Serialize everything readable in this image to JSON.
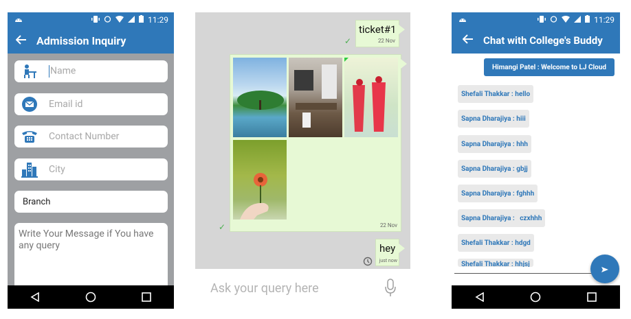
{
  "status": {
    "time": "11:29"
  },
  "screen1": {
    "title": "Admission Inquiry",
    "fields": [
      {
        "placeholder": "Name",
        "icon": "person-at-desk-icon"
      },
      {
        "placeholder": "Email id",
        "icon": "envelope-icon"
      },
      {
        "placeholder": "Contact Number",
        "icon": "telephone-icon"
      },
      {
        "placeholder": "City",
        "icon": "city-buildings-icon"
      }
    ],
    "branch": "Branch",
    "message_placeholder": "Write Your Message if You have any query"
  },
  "screen2": {
    "messages": [
      {
        "text": "ticket#1",
        "date": "22 Nov"
      },
      {
        "type": "images",
        "count": 4,
        "date": "22 Nov"
      },
      {
        "text": "hey",
        "date": "just now"
      }
    ],
    "input_placeholder": "Ask your query here"
  },
  "screen3": {
    "title": "Chat with College's Buddy",
    "welcome": "Himangi Patel : Welcome to LJ Cloud",
    "messages": [
      "Shefali Thakkar : hello",
      "Sapna Dharajiya : hiii",
      "Sapna Dharajiya : hhh",
      "Sapna Dharajiya : gbjj",
      "Sapna Dharajiya : fghhh",
      "Sapna Dharajiya :   czxhhh",
      "Shefali Thakkar : hdgd",
      "Shefali Thakkar : hhjsj"
    ]
  },
  "colors": {
    "primary": "#2f78b9",
    "bubble": "#e7f9d5",
    "phone1_bg": "#9ea0a3",
    "chat_bg": "#d6d6d6"
  }
}
